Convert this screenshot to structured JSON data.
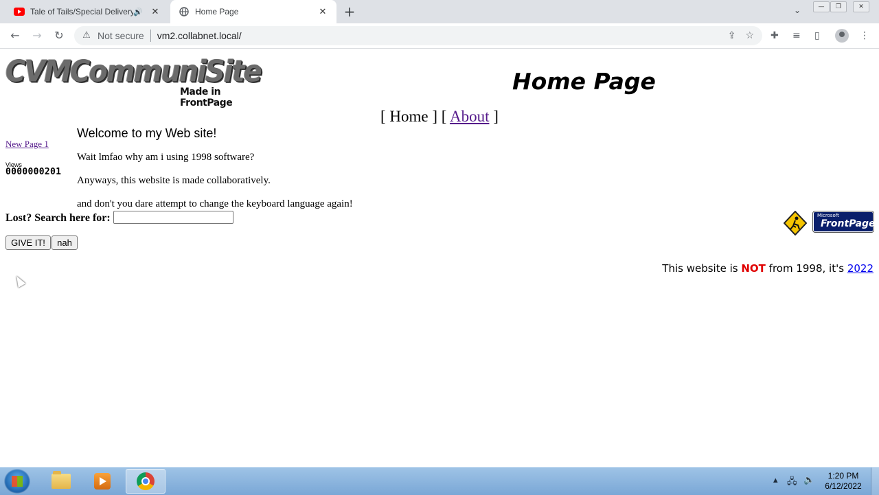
{
  "browser": {
    "tabs": [
      {
        "title": "Tale of Tails/Special Delivery",
        "favicon": "youtube-icon",
        "audio": true,
        "active": false
      },
      {
        "title": "Home Page",
        "favicon": "globe-icon",
        "active": true
      }
    ],
    "security_label": "Not secure",
    "url": "vm2.collabnet.local/"
  },
  "page": {
    "logo_text": "CVMCommuniSite",
    "logo_sub": "Made in FrontPage",
    "heading": "Home Page",
    "nav": {
      "open": "[",
      "home": "Home",
      "mid": "] [",
      "about": "About",
      "close": "]"
    },
    "sidebar": {
      "link": "New Page 1",
      "views_label": "Views",
      "views_count": "0000000201"
    },
    "welcome": "Welcome to my Web site!",
    "paragraphs": [
      "Wait lmfao why am i using 1998 software?",
      "Anyways, this website is made collaboratively.",
      "and don't you dare attempt to change the keyboard language again!"
    ],
    "search": {
      "label": "Lost? Search here for:",
      "value": "",
      "submit": "GIVE IT!",
      "reset": "nah"
    },
    "badges": {
      "frontpage_small": "Microsoft",
      "frontpage_big": "FrontPage"
    },
    "footer": {
      "pre": "This website is ",
      "not": "NOT",
      "mid": " from 1998, it's ",
      "year": "2022"
    }
  },
  "taskbar": {
    "time": "1:20 PM",
    "date": "6/12/2022"
  },
  "colors": {
    "link_visited": "#551a8b",
    "link": "#0000ee",
    "not_red": "#e00000"
  }
}
